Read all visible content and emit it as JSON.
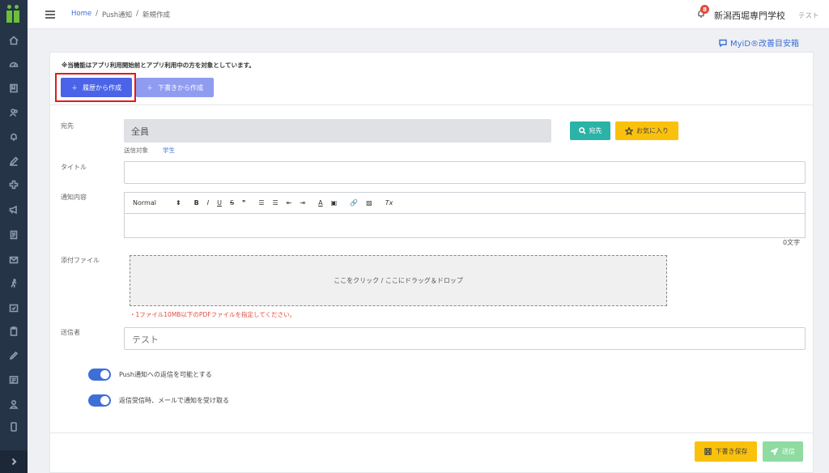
{
  "breadcrumb": {
    "home": "Home",
    "sep1": "/",
    "section": "Push通知",
    "sep2": "/",
    "current": "新規作成"
  },
  "header": {
    "notification_count": "8",
    "school_name": "新潟西堀専門学校",
    "user_name": "テスト"
  },
  "improve_link": "MyiD®改善目安箱",
  "notice": "※当機能はアプリ利用開始前とアプリ利用中の方を対象としています。",
  "actions": {
    "create_from_history": "履歴から作成",
    "create_from_draft": "下書きから作成"
  },
  "form": {
    "destination_label": "宛先",
    "destination_value": "全員",
    "target_label": "送信対象",
    "target_value": "学生",
    "destination_button": "宛先",
    "favorites_button": "お気に入り",
    "title_label": "タイトル",
    "content_label": "通知内容",
    "char_count": "0文字",
    "attachment_label": "添付ファイル",
    "dropzone_text": "ここをクリック / ここにドラッグ＆ドロップ",
    "attachment_note": "・1ファイル10MB以下のPDFファイルを指定してください。",
    "sender_label": "送信者",
    "sender_value": "テスト"
  },
  "editor_toolbar": {
    "format": "Normal",
    "format_arrow": "⬍",
    "bold": "B",
    "italic": "I",
    "underline": "U",
    "strike": "S",
    "quote": "❞",
    "ordered_list": "☰",
    "bullet_list": "☰",
    "indent_less": "⇤",
    "indent_more": "⇥",
    "text_color": "A",
    "background": "▣",
    "link": "🔗",
    "image": "▨",
    "clean": "Tx"
  },
  "toggles": [
    {
      "label": "Push通知への返信を可能とする",
      "on": true
    },
    {
      "label": "返信受信時、メールで通知を受け取る",
      "on": true
    }
  ],
  "footer": {
    "save_draft": "下書き保存",
    "send": "送信"
  },
  "colors": {
    "sidebar": "#253447",
    "primary": "#4a63e8",
    "teal": "#2ab3a6",
    "yellow": "#fac10c",
    "green_disabled": "#8fdba2",
    "highlight": "#e01b1b"
  },
  "sidebar_icons": [
    "home-icon",
    "dashboard-icon",
    "book-icon",
    "users-icon",
    "bell-icon",
    "pen-icon",
    "plus-cross-icon",
    "megaphone-icon",
    "document-icon",
    "mail-icon",
    "runner-icon",
    "calendar-check-icon",
    "clipboard-icon",
    "pencil-icon",
    "list-icon",
    "user-icon",
    "mobile-icon"
  ]
}
